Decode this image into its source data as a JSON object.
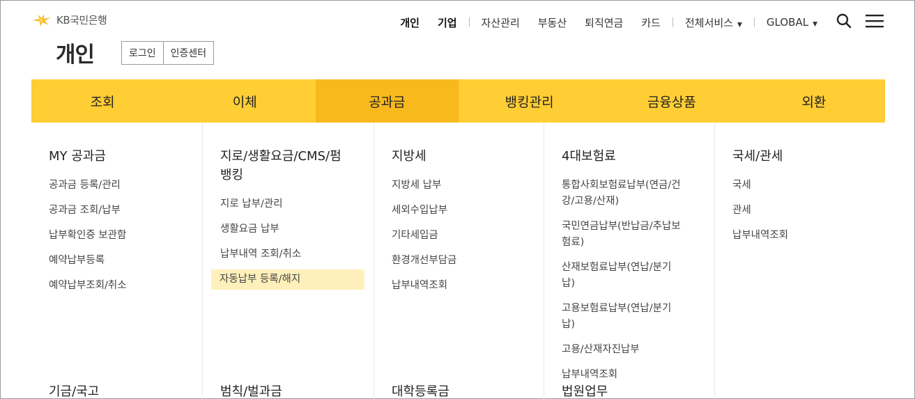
{
  "header": {
    "logo_text": "KB국민은행",
    "topnav": [
      {
        "label": "개인",
        "bold": true
      },
      {
        "label": "기업",
        "bold": true
      },
      {
        "label": "자산관리"
      },
      {
        "label": "부동산"
      },
      {
        "label": "퇴직연금"
      },
      {
        "label": "카드"
      },
      {
        "label": "전체서비스"
      },
      {
        "label": "GLOBAL"
      }
    ]
  },
  "page": {
    "title": "개인",
    "login_label": "로그인",
    "cert_label": "인증센터"
  },
  "gnb": {
    "tabs": [
      "조회",
      "이체",
      "공과금",
      "뱅킹관리",
      "금융상품",
      "외환"
    ],
    "active": "공과금"
  },
  "panel": {
    "columns": [
      {
        "title": "MY 공과금",
        "items": [
          "공과금 등록/관리",
          "공과금 조회/납부",
          "납부확인증 보관함",
          "예약납부등록",
          "예약납부조회/취소"
        ],
        "bottom": "기금/국고"
      },
      {
        "title": "지로/생활요금/CMS/펌뱅킹",
        "items": [
          "지로 납부/관리",
          "생활요금 납부",
          "납부내역 조회/취소",
          "자동납부 등록/해지"
        ],
        "bottom": "범칙/벌과금"
      },
      {
        "title": "지방세",
        "items": [
          "지방세 납부",
          "세외수입납부",
          "기타세입금",
          "환경개선부담금",
          "납부내역조회"
        ],
        "bottom": "대학등록금"
      },
      {
        "title": "4대보험료",
        "items": [
          "통합사회보험료납부(연금/건강/고용/산재)",
          "국민연금납부(반납금/추납보험료)",
          "산재보험료납부(연납/분기납)",
          "고용보험료납부(연납/분기납)",
          "고용/산재자진납부",
          "납부내역조회"
        ],
        "bottom": "법원업무"
      },
      {
        "title": "국세/관세",
        "items": [
          "국세",
          "관세",
          "납부내역조회"
        ]
      }
    ],
    "highlighted_item": "자동납부 등록/해지"
  },
  "colors": {
    "gnb_bg": "#ffcd34",
    "gnb_active": "#f8b91d",
    "highlight": "#fff0bb"
  }
}
